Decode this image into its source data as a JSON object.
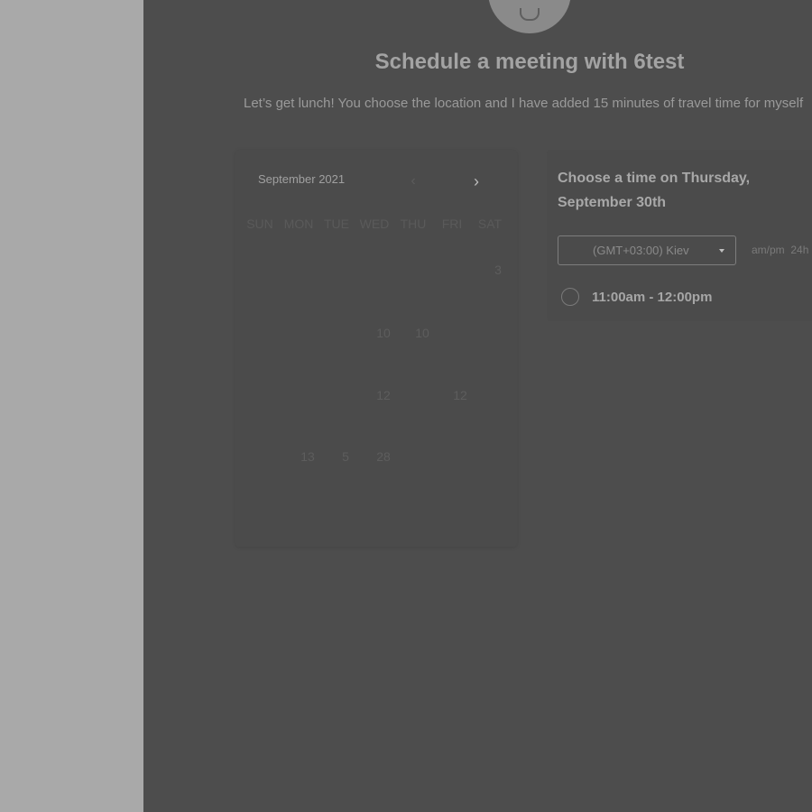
{
  "header": {
    "title": "Schedule a meeting with 6test",
    "description": "Let’s get lunch! You choose the location and I have added 15 minutes of travel time for myself"
  },
  "calendar": {
    "month_label": "September 2021",
    "prev_icon": "chevron-left-icon",
    "next_icon": "chevron-right-icon",
    "weekdays": [
      "SUN",
      "MON",
      "TUE",
      "WED",
      "THU",
      "FRI",
      "SAT"
    ],
    "visible_days": [
      "3",
      "10",
      "10",
      "12",
      "12",
      "13",
      "5",
      "28"
    ]
  },
  "time_picker": {
    "heading_line1": "Choose a time on Thursday,",
    "heading_line2": "September 30th",
    "timezone": "(GMT+03:00) Kiev",
    "format_ampm": "am/pm",
    "format_24h": "24h",
    "slots": [
      {
        "label": "11:00am - 12:00pm"
      }
    ]
  },
  "colors": {
    "overlay": "#4d4d4d",
    "sidebar": "#a9a9a9"
  }
}
